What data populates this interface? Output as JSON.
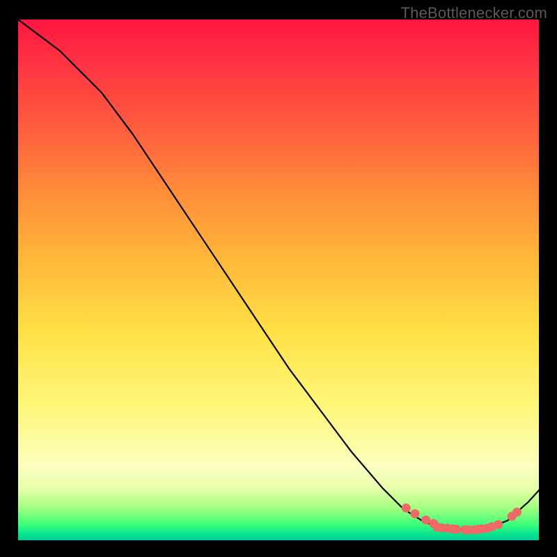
{
  "watermark": "TheBottlenecker.com",
  "chart_data": {
    "type": "line",
    "title": "",
    "xlabel": "",
    "ylabel": "",
    "xlim": [
      0,
      100
    ],
    "ylim": [
      0,
      100
    ],
    "grid": false,
    "legend": false,
    "series": [
      {
        "name": "curve",
        "color": "#000000",
        "x": [
          0,
          4,
          8,
          12,
          16,
          22,
          28,
          34,
          40,
          46,
          52,
          58,
          64,
          70,
          74,
          78,
          82,
          86,
          90,
          94,
          98,
          100
        ],
        "y": [
          100,
          97,
          94,
          90,
          86,
          78,
          69,
          60,
          51,
          42,
          33,
          25,
          17,
          10,
          6,
          3.5,
          2.2,
          1.8,
          2.2,
          3.8,
          7.4,
          9.6
        ]
      }
    ],
    "points": {
      "name": "dots",
      "color": "#ef6a66",
      "x": [
        74.5,
        76.2,
        78.3,
        79.8,
        80.5,
        81.3,
        82.4,
        83.5,
        84.2,
        85.8,
        86.5,
        87.6,
        88.4,
        89.0,
        90.1,
        91.0,
        92.2,
        94.8,
        95.8
      ],
      "y": [
        6.2,
        5.1,
        3.9,
        3.2,
        2.5,
        2.4,
        2.3,
        2.2,
        2.1,
        2.0,
        2.0,
        2.0,
        2.1,
        2.2,
        2.3,
        2.6,
        3.0,
        4.6,
        5.4
      ]
    }
  }
}
